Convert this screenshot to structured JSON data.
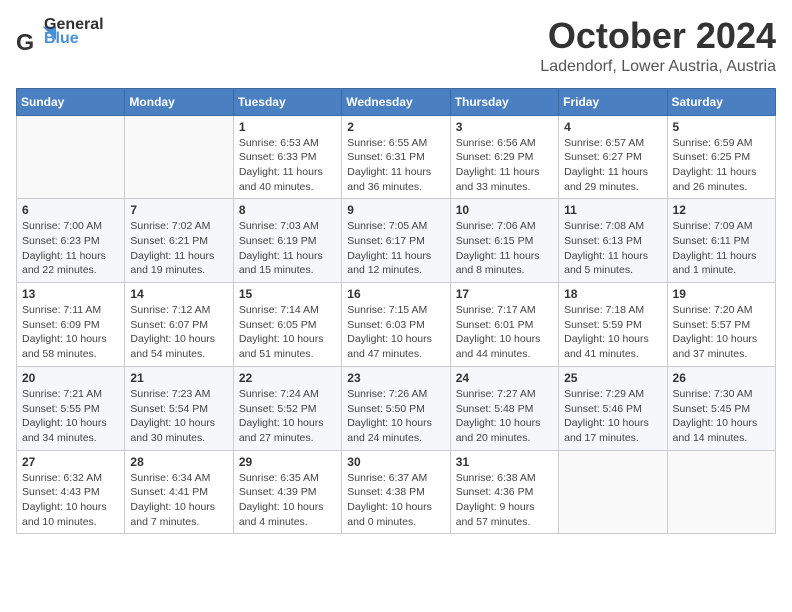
{
  "header": {
    "logo_general": "General",
    "logo_blue": "Blue",
    "month_title": "October 2024",
    "location": "Ladendorf, Lower Austria, Austria"
  },
  "days_of_week": [
    "Sunday",
    "Monday",
    "Tuesday",
    "Wednesday",
    "Thursday",
    "Friday",
    "Saturday"
  ],
  "weeks": [
    [
      {
        "day": "",
        "info": ""
      },
      {
        "day": "",
        "info": ""
      },
      {
        "day": "1",
        "info": "Sunrise: 6:53 AM\nSunset: 6:33 PM\nDaylight: 11 hours and 40 minutes."
      },
      {
        "day": "2",
        "info": "Sunrise: 6:55 AM\nSunset: 6:31 PM\nDaylight: 11 hours and 36 minutes."
      },
      {
        "day": "3",
        "info": "Sunrise: 6:56 AM\nSunset: 6:29 PM\nDaylight: 11 hours and 33 minutes."
      },
      {
        "day": "4",
        "info": "Sunrise: 6:57 AM\nSunset: 6:27 PM\nDaylight: 11 hours and 29 minutes."
      },
      {
        "day": "5",
        "info": "Sunrise: 6:59 AM\nSunset: 6:25 PM\nDaylight: 11 hours and 26 minutes."
      }
    ],
    [
      {
        "day": "6",
        "info": "Sunrise: 7:00 AM\nSunset: 6:23 PM\nDaylight: 11 hours and 22 minutes."
      },
      {
        "day": "7",
        "info": "Sunrise: 7:02 AM\nSunset: 6:21 PM\nDaylight: 11 hours and 19 minutes."
      },
      {
        "day": "8",
        "info": "Sunrise: 7:03 AM\nSunset: 6:19 PM\nDaylight: 11 hours and 15 minutes."
      },
      {
        "day": "9",
        "info": "Sunrise: 7:05 AM\nSunset: 6:17 PM\nDaylight: 11 hours and 12 minutes."
      },
      {
        "day": "10",
        "info": "Sunrise: 7:06 AM\nSunset: 6:15 PM\nDaylight: 11 hours and 8 minutes."
      },
      {
        "day": "11",
        "info": "Sunrise: 7:08 AM\nSunset: 6:13 PM\nDaylight: 11 hours and 5 minutes."
      },
      {
        "day": "12",
        "info": "Sunrise: 7:09 AM\nSunset: 6:11 PM\nDaylight: 11 hours and 1 minute."
      }
    ],
    [
      {
        "day": "13",
        "info": "Sunrise: 7:11 AM\nSunset: 6:09 PM\nDaylight: 10 hours and 58 minutes."
      },
      {
        "day": "14",
        "info": "Sunrise: 7:12 AM\nSunset: 6:07 PM\nDaylight: 10 hours and 54 minutes."
      },
      {
        "day": "15",
        "info": "Sunrise: 7:14 AM\nSunset: 6:05 PM\nDaylight: 10 hours and 51 minutes."
      },
      {
        "day": "16",
        "info": "Sunrise: 7:15 AM\nSunset: 6:03 PM\nDaylight: 10 hours and 47 minutes."
      },
      {
        "day": "17",
        "info": "Sunrise: 7:17 AM\nSunset: 6:01 PM\nDaylight: 10 hours and 44 minutes."
      },
      {
        "day": "18",
        "info": "Sunrise: 7:18 AM\nSunset: 5:59 PM\nDaylight: 10 hours and 41 minutes."
      },
      {
        "day": "19",
        "info": "Sunrise: 7:20 AM\nSunset: 5:57 PM\nDaylight: 10 hours and 37 minutes."
      }
    ],
    [
      {
        "day": "20",
        "info": "Sunrise: 7:21 AM\nSunset: 5:55 PM\nDaylight: 10 hours and 34 minutes."
      },
      {
        "day": "21",
        "info": "Sunrise: 7:23 AM\nSunset: 5:54 PM\nDaylight: 10 hours and 30 minutes."
      },
      {
        "day": "22",
        "info": "Sunrise: 7:24 AM\nSunset: 5:52 PM\nDaylight: 10 hours and 27 minutes."
      },
      {
        "day": "23",
        "info": "Sunrise: 7:26 AM\nSunset: 5:50 PM\nDaylight: 10 hours and 24 minutes."
      },
      {
        "day": "24",
        "info": "Sunrise: 7:27 AM\nSunset: 5:48 PM\nDaylight: 10 hours and 20 minutes."
      },
      {
        "day": "25",
        "info": "Sunrise: 7:29 AM\nSunset: 5:46 PM\nDaylight: 10 hours and 17 minutes."
      },
      {
        "day": "26",
        "info": "Sunrise: 7:30 AM\nSunset: 5:45 PM\nDaylight: 10 hours and 14 minutes."
      }
    ],
    [
      {
        "day": "27",
        "info": "Sunrise: 6:32 AM\nSunset: 4:43 PM\nDaylight: 10 hours and 10 minutes."
      },
      {
        "day": "28",
        "info": "Sunrise: 6:34 AM\nSunset: 4:41 PM\nDaylight: 10 hours and 7 minutes."
      },
      {
        "day": "29",
        "info": "Sunrise: 6:35 AM\nSunset: 4:39 PM\nDaylight: 10 hours and 4 minutes."
      },
      {
        "day": "30",
        "info": "Sunrise: 6:37 AM\nSunset: 4:38 PM\nDaylight: 10 hours and 0 minutes."
      },
      {
        "day": "31",
        "info": "Sunrise: 6:38 AM\nSunset: 4:36 PM\nDaylight: 9 hours and 57 minutes."
      },
      {
        "day": "",
        "info": ""
      },
      {
        "day": "",
        "info": ""
      }
    ]
  ]
}
